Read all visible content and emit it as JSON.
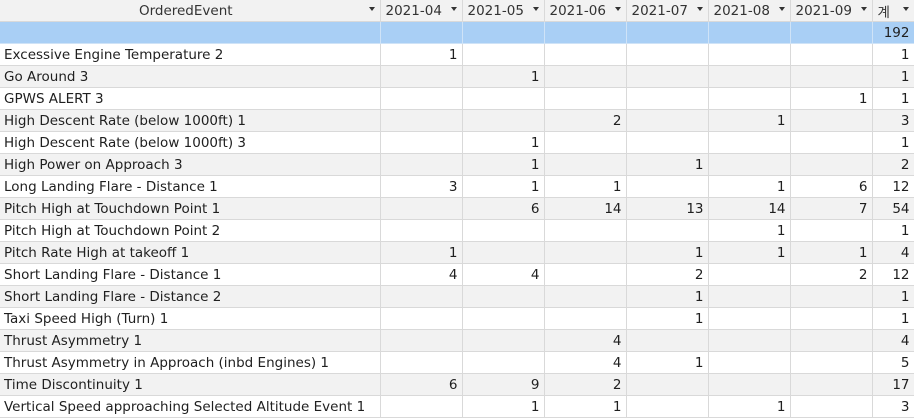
{
  "header": {
    "event_col": "OrderedEvent",
    "months": [
      "2021-04",
      "2021-05",
      "2021-06",
      "2021-07",
      "2021-08",
      "2021-09"
    ],
    "total_col": "계"
  },
  "grand_total": "192",
  "rows": [
    {
      "event": "Excessive Engine Temperature 2",
      "vals": [
        "1",
        "",
        "",
        "",
        "",
        ""
      ],
      "total": "1"
    },
    {
      "event": "Go Around 3",
      "vals": [
        "",
        "1",
        "",
        "",
        "",
        ""
      ],
      "total": "1"
    },
    {
      "event": "GPWS ALERT 3",
      "vals": [
        "",
        "",
        "",
        "",
        "",
        "1"
      ],
      "total": "1"
    },
    {
      "event": "High Descent Rate (below 1000ft) 1",
      "vals": [
        "",
        "",
        "2",
        "",
        "1",
        ""
      ],
      "total": "3"
    },
    {
      "event": "High Descent Rate (below 1000ft) 3",
      "vals": [
        "",
        "1",
        "",
        "",
        "",
        ""
      ],
      "total": "1"
    },
    {
      "event": "High Power on Approach 3",
      "vals": [
        "",
        "1",
        "",
        "1",
        "",
        ""
      ],
      "total": "2"
    },
    {
      "event": "Long Landing Flare - Distance 1",
      "vals": [
        "3",
        "1",
        "1",
        "",
        "1",
        "6"
      ],
      "total": "12"
    },
    {
      "event": "Pitch High at Touchdown Point 1",
      "vals": [
        "",
        "6",
        "14",
        "13",
        "14",
        "7"
      ],
      "total": "54"
    },
    {
      "event": "Pitch High at Touchdown Point 2",
      "vals": [
        "",
        "",
        "",
        "",
        "1",
        ""
      ],
      "total": "1"
    },
    {
      "event": "Pitch Rate High at takeoff 1",
      "vals": [
        "1",
        "",
        "",
        "1",
        "1",
        "1"
      ],
      "total": "4"
    },
    {
      "event": "Short Landing Flare - Distance 1",
      "vals": [
        "4",
        "4",
        "",
        "2",
        "",
        "2"
      ],
      "total": "12"
    },
    {
      "event": "Short Landing Flare - Distance 2",
      "vals": [
        "",
        "",
        "",
        "1",
        "",
        ""
      ],
      "total": "1"
    },
    {
      "event": "Taxi Speed High (Turn) 1",
      "vals": [
        "",
        "",
        "",
        "1",
        "",
        ""
      ],
      "total": "1"
    },
    {
      "event": "Thrust Asymmetry 1",
      "vals": [
        "",
        "",
        "4",
        "",
        "",
        ""
      ],
      "total": "4"
    },
    {
      "event": "Thrust Asymmetry in Approach (inbd Engines) 1",
      "vals": [
        "",
        "",
        "4",
        "1",
        "",
        ""
      ],
      "total": "5"
    },
    {
      "event": "Time Discontinuity 1",
      "vals": [
        "6",
        "9",
        "2",
        "",
        "",
        ""
      ],
      "total": "17"
    },
    {
      "event": "Vertical Speed approaching Selected Altitude Event 1",
      "vals": [
        "",
        "1",
        "1",
        "",
        "1",
        ""
      ],
      "total": "3"
    }
  ],
  "colors": {
    "header_bg": "#f2f2f2",
    "total_row_bg": "#a9cff5",
    "stripe_bg": "#f2f2f2",
    "grid_line": "#d9d9d9"
  }
}
